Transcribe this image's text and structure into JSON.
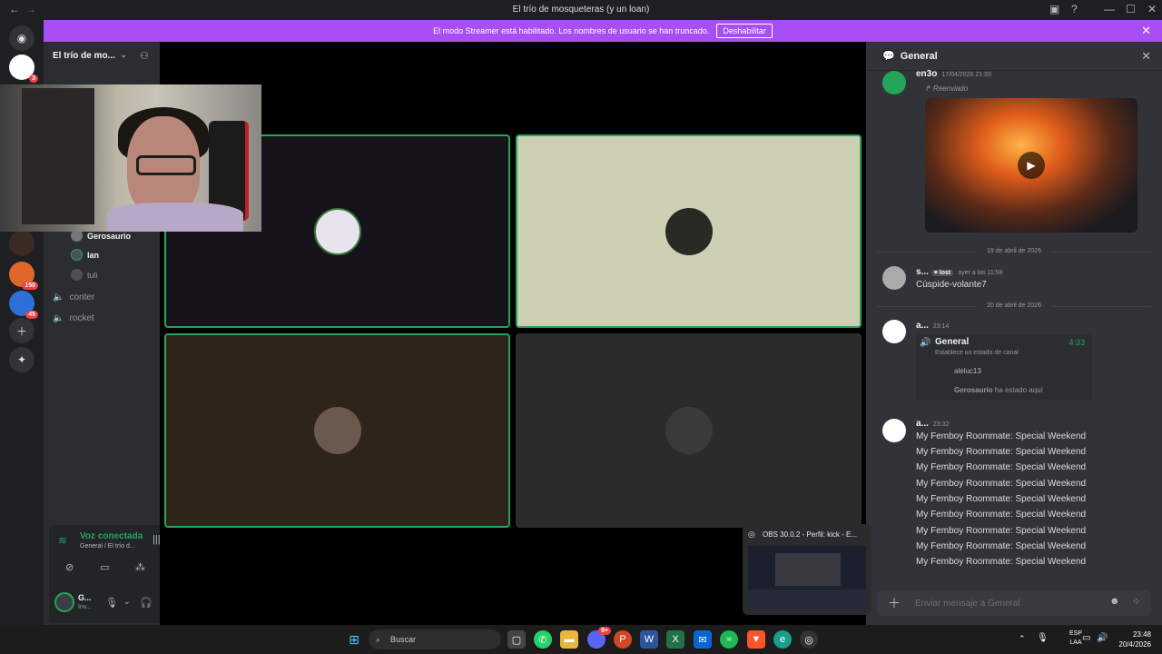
{
  "window": {
    "title": "El trío de mosqueteras (y un loan)",
    "help": "?",
    "minimize": "—",
    "maximize": "☐",
    "close": "✕"
  },
  "banner": {
    "text": "El modo Streamer está habilitado. Los nombres de usuario se han truncado.",
    "button": "Deshabilitar"
  },
  "rail": {
    "badges": {
      "srv1": "3",
      "srv3": "150",
      "srv4": "45"
    }
  },
  "sidebar": {
    "server_name": "El trío de mo...",
    "voice_users": [
      "Gerosaurio",
      "lan",
      "tuli"
    ],
    "channels": [
      "conter",
      "rocket"
    ],
    "voice_panel": {
      "status": "Voz conectada",
      "location": "General / El trío d...",
      "user_short": "G...",
      "user_status": "Inv..."
    }
  },
  "chat": {
    "channel": "General",
    "composer_placeholder": "Enviar mensaje a General",
    "messages": [
      {
        "author": "en3o",
        "time": "17/04/2026 21:33",
        "forwarded": "Reenviado"
      },
      {
        "date_divider": "19 de abril de 2026"
      },
      {
        "author": "s...",
        "tag": "lost",
        "time": "ayer a las 11:58",
        "text": "Cúspide-volante7"
      },
      {
        "date_divider": "20 de abril de 2026"
      },
      {
        "author": "a...",
        "time": "23:14",
        "voice_card": {
          "channel": "General",
          "duration": "4:33",
          "status": "Establece un estado de canal",
          "user1": "aleluc13",
          "user2": "Gerosaurio",
          "user2_suffix": "ha estado aquí"
        }
      },
      {
        "author": "a...",
        "time": "23:32",
        "lines": [
          "My Femboy Roommate: Special Weekend",
          "My Femboy Roommate: Special Weekend",
          "My Femboy Roommate: Special Weekend",
          "My Femboy Roommate: Special Weekend",
          "My Femboy Roommate: Special Weekend",
          "My Femboy Roommate: Special Weekend",
          "My Femboy Roommate: Special Weekend",
          "My Femboy Roommate: Special Weekend",
          "My Femboy Roommate: Special Weekend"
        ]
      }
    ]
  },
  "obs_preview": {
    "title": "OBS 30.0.2 - Perfil: kick - E..."
  },
  "taskbar": {
    "search": "Buscar",
    "lang": [
      "ESP",
      "LAA"
    ],
    "time": "23:48",
    "date": "20/4/2026",
    "discord_badge": "9+"
  },
  "colors": {
    "accent": "#a74ef5",
    "speaking": "#23a55a",
    "danger": "#f23f43"
  }
}
